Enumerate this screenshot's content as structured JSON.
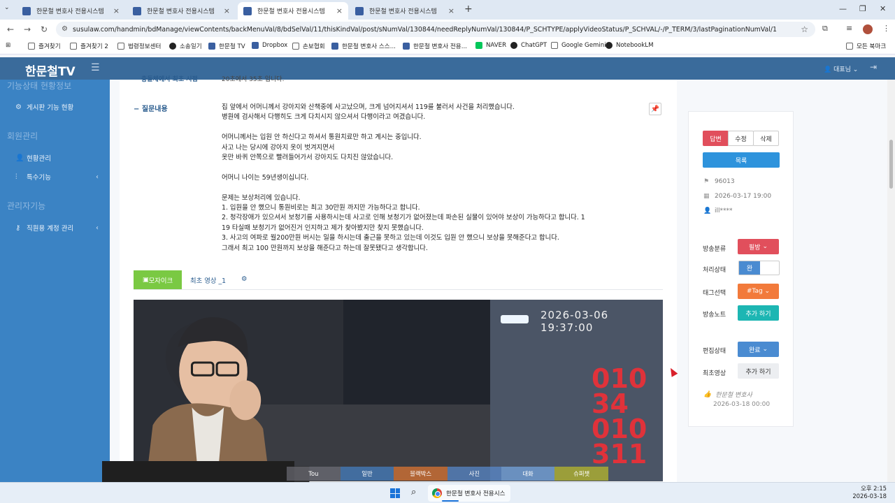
{
  "browser": {
    "tabs": [
      {
        "label": "한문철 변호사 전용시스템",
        "active": false
      },
      {
        "label": "한문철 변호사 전용시스템",
        "active": false
      },
      {
        "label": "한문철 변호사 전용시스템",
        "active": true
      },
      {
        "label": "한문철 변호사 전용시스템",
        "active": false
      }
    ],
    "url": "susulaw.com/handmin/bdManage/viewContents/backMenuVal/8/bdSelVal/11/thisKindVal/post/sNumVal/130844/needReplyNumVal/130844/P_SCHTYPE/applyVideoStatus/P_SCHVAL/-/P_TERM/3/lastPaginationNumVal/1",
    "bookmarks": [
      "즐겨찾기",
      "즐겨찾기 2",
      "법령정보센터",
      "소송일기",
      "한문철 TV",
      "Dropbox",
      "손보협회",
      "한문철 변호사 스스...",
      "한문철 변호사 전용...",
      "NAVER",
      "ChatGPT",
      "Google Gemini",
      "NotebookLM"
    ],
    "all_bookmarks": "모든 북마크"
  },
  "app": {
    "logo": "한문철TV",
    "user": "대표님"
  },
  "sidebar": {
    "section1": "기능상태 현황정보",
    "item1": "게시판 기능 현황",
    "section2": "회원관리",
    "item2": "현황관리",
    "item3": "특수기능",
    "section3": "관리자기능",
    "item4": "직원용 계정 관리"
  },
  "post": {
    "top_label": "충돌체에서 최초 시점",
    "top_value": "20초에서 35초 입니다.",
    "question_label": "질문내용",
    "question_lines": [
      "집 앞에서 어머니께서 강아지와 산책중에 사고났으며, 크게 넘어지셔서 119를 불러서 사건을 처리했습니다.",
      "병원에 검사해서 다행히도 크게 다치시지 않으셔서 다행이라고 여겼습니다.",
      "",
      "어머니께서는 입원 안 하신다고 하셔서 통원치료만 하고 계시는 중입니다.",
      "사고 나는 당시에 강아지 옷이 벗겨지면서",
      "옷만 바퀴 안쪽으로 빨려들어가서 강아지도 다치진 않았습니다.",
      "",
      "어머니 나이는 59년생이십니다.",
      "",
      "문제는 보상처리에 있습니다.",
      "1. 입원을 안 했으니 통원비로는 최고 30만원 까지만 가능하다고 합니다.",
      "2. 청각장애가 있으셔서 보청기를 사용하시는데 사고로 인해 보청기가 없어졌는데 파손된 실물이 있어야 보상이 가능하다고 합니다. 1",
      "19 타실때 보청기가 없어진거 인지하고 제가 찾아봤지만 찾지 못했습니다.",
      "3. 사고의 여파로 월200만원 버시는 일을 하시는데 출근을 못하고 있는데 이것도 입원 안 했으니 보상을 못해준다고 합니다.",
      "그래서 최고 100 만원까지 보상을 해준다고 하는데 잘못됐다고 생각합니다."
    ],
    "video_tabs": {
      "mosaic": "모자이크",
      "first_video": "최초 영상 _1"
    },
    "video_timestamp": "2026-03-06 19:37:00",
    "video_sign": "010 34\n010 311",
    "video_controls": [
      "Tou",
      "일반",
      "블랙박스",
      "사진",
      "대화",
      "슈퍼챗"
    ]
  },
  "right_panel": {
    "btn_reply": "답변",
    "btn_edit": "수정",
    "btn_delete": "삭제",
    "btn_list": "목록",
    "post_number": "96013",
    "post_date": "2026-03-17 19:00",
    "author": "ill****",
    "broadcast_type_label": "방송분류",
    "broadcast_type_value": "필방",
    "process_label": "처리상태",
    "process_value": "완",
    "tag_label": "태그선택",
    "tag_value": "#Tag",
    "note_label": "방송노트",
    "note_btn": "추가 하기",
    "edit_status_label": "편집상태",
    "edit_status_value": "완료",
    "first_video_label": "최초영상",
    "first_video_btn": "추가 하기",
    "footer_author": "한문철 변호사",
    "footer_date": "2026-03-18 00:00"
  },
  "taskbar": {
    "app_label": "한문철 변호사 전용시스",
    "time": "오후 2:15",
    "date": "2026-03-18"
  }
}
